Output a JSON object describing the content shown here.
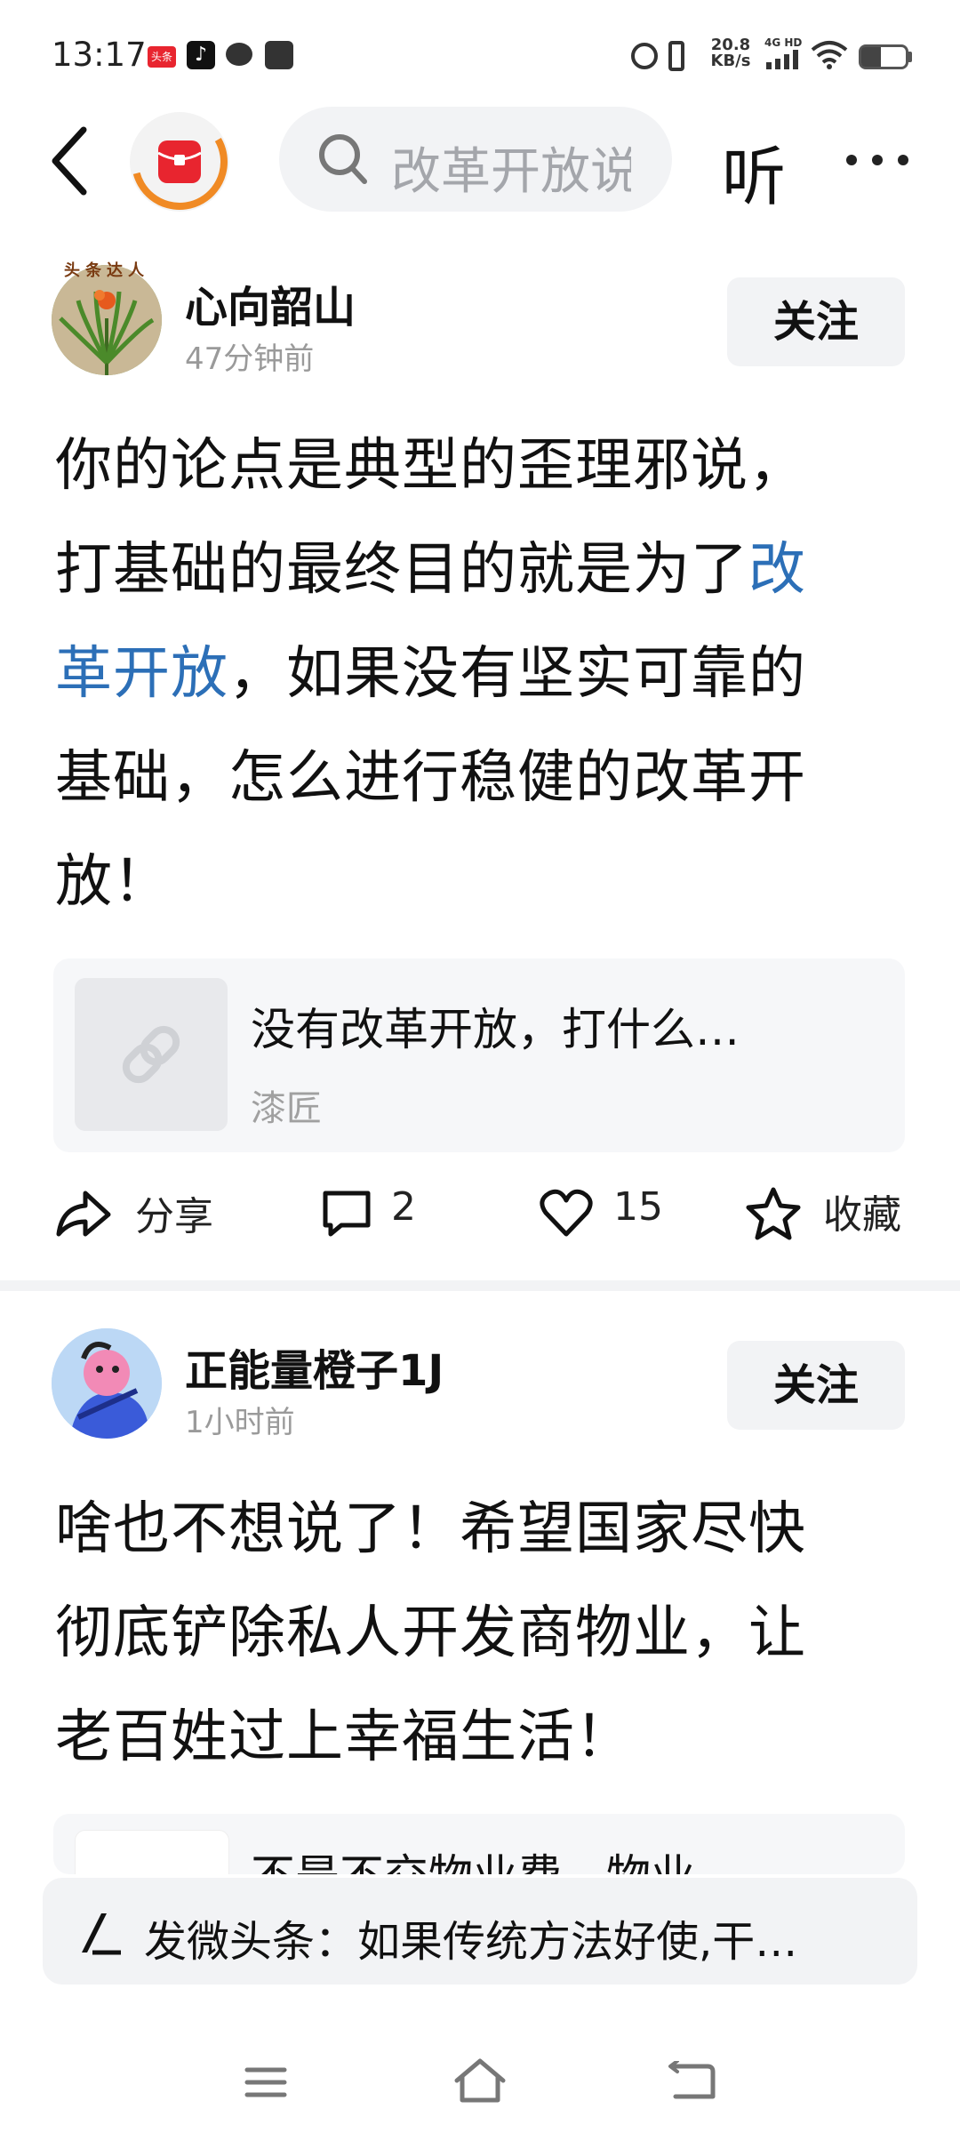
{
  "status_bar": {
    "time": "13:17",
    "notif_badge": "头条",
    "net_speed_value": "20.8",
    "net_speed_unit": "KB/s",
    "network_label": "4G HD",
    "icons": [
      "toutiao-icon",
      "tiktok-icon",
      "chat-bubble-icon",
      "message-box-icon",
      "alarm-icon",
      "vibrate-icon",
      "signal-icon",
      "wifi-icon",
      "battery-icon"
    ]
  },
  "top_nav": {
    "search_text": "改革开放说",
    "listen_label": "听"
  },
  "posts": [
    {
      "author": "心向韶山",
      "time": "47分钟前",
      "follow_label": "关注",
      "avatar_badge": "头条达人",
      "text_line1": "你的论点是典型的歪理邪说，",
      "text_line2_a": "打基础的最终目的就是为了",
      "text_line2_link": "改",
      "text_line3_link": "革开放",
      "text_line3_b": "，如果没有坚实可靠的",
      "text_line4": "基础，怎么进行稳健的改革开",
      "text_line5": "放！",
      "card_title": "没有改革开放，打什么…",
      "card_source": "漆匠",
      "actions": {
        "share": "分享",
        "comments": "2",
        "likes": "15",
        "favorite": "收藏"
      }
    },
    {
      "author": "正能量橙子1J",
      "time": "1小时前",
      "follow_label": "关注",
      "text_line1": "啥也不想说了！希望国家尽快",
      "text_line2": "彻底铲除私人开发商物业，让",
      "text_line3": "老百姓过上幸福生活！",
      "card_title_partial": "不是不交物业费，物业"
    }
  ],
  "bottom_bar": {
    "text": "发微头条：如果传统方法好使,干…"
  },
  "colors": {
    "link": "#2c6fb7",
    "accent_orange": "#f08a24",
    "brand_red": "#e8252f"
  }
}
